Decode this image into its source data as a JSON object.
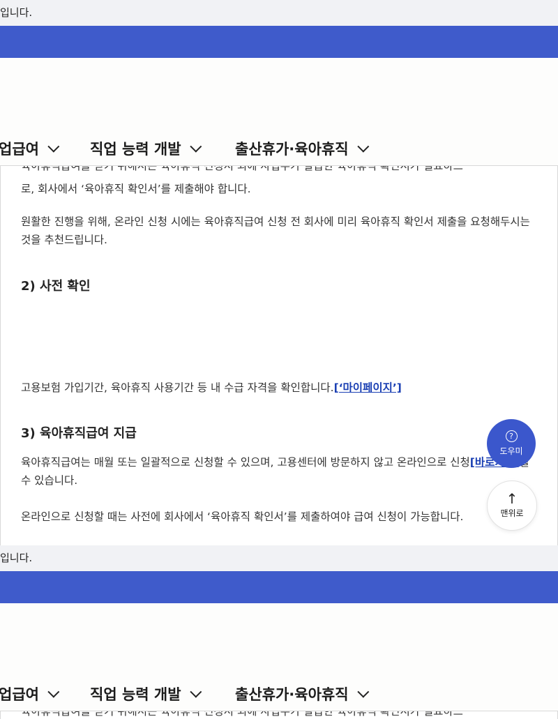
{
  "notice": {
    "text": "입니다."
  },
  "nav": {
    "items": [
      {
        "label": "업급여"
      },
      {
        "label": "직업 능력 개발"
      },
      {
        "label": "출산휴가·육아휴직"
      }
    ]
  },
  "content": {
    "cutoff_line": "육아휴직급여를 받기 위해서는 육아휴직 신청서 외에 사업주가 발급한 육아휴직 확인서가 필요하므",
    "para1": "로, 회사에서 ‘육아휴직 확인서’를 제출해야 합니다.",
    "para2": "원활한 진행을 위해, 온라인 신청 시에는 육아휴직급여 신청 전 회사에 미리 육아휴직 확인서 제출을 요청해두시는 것을 추천드립니다.",
    "heading2": "2) 사전 확인",
    "para3_text": "고용보험 가입기간, 육아휴직 사용기간 등 내 수급 자격을 확인합니다.",
    "para3_link": "[‘마이페이지’]",
    "heading3": "3) 육아휴직급여 지급",
    "para4_text": "육아휴직급여는 매월 또는 일괄적으로 신청할 수 있으며, 고용센터에 방문하지 않고 온라인으로 신청",
    "para4_link": "[바로가기]",
    "para4_tail": "할 수 있습니다.",
    "para5": "온라인으로 신청할 때는 사전에 회사에서 ‘육아휴직 확인서’를 제출하여야 급여 신청이 가능합니다."
  },
  "floating": {
    "help_label": "도우미",
    "help_icon": "question-circle-icon",
    "top_label": "맨위로",
    "top_icon": "arrow-up-icon"
  },
  "colors": {
    "accent": "#3f5bcb",
    "link": "#1a3fb3",
    "notice_bg": "#f1f2f5"
  }
}
